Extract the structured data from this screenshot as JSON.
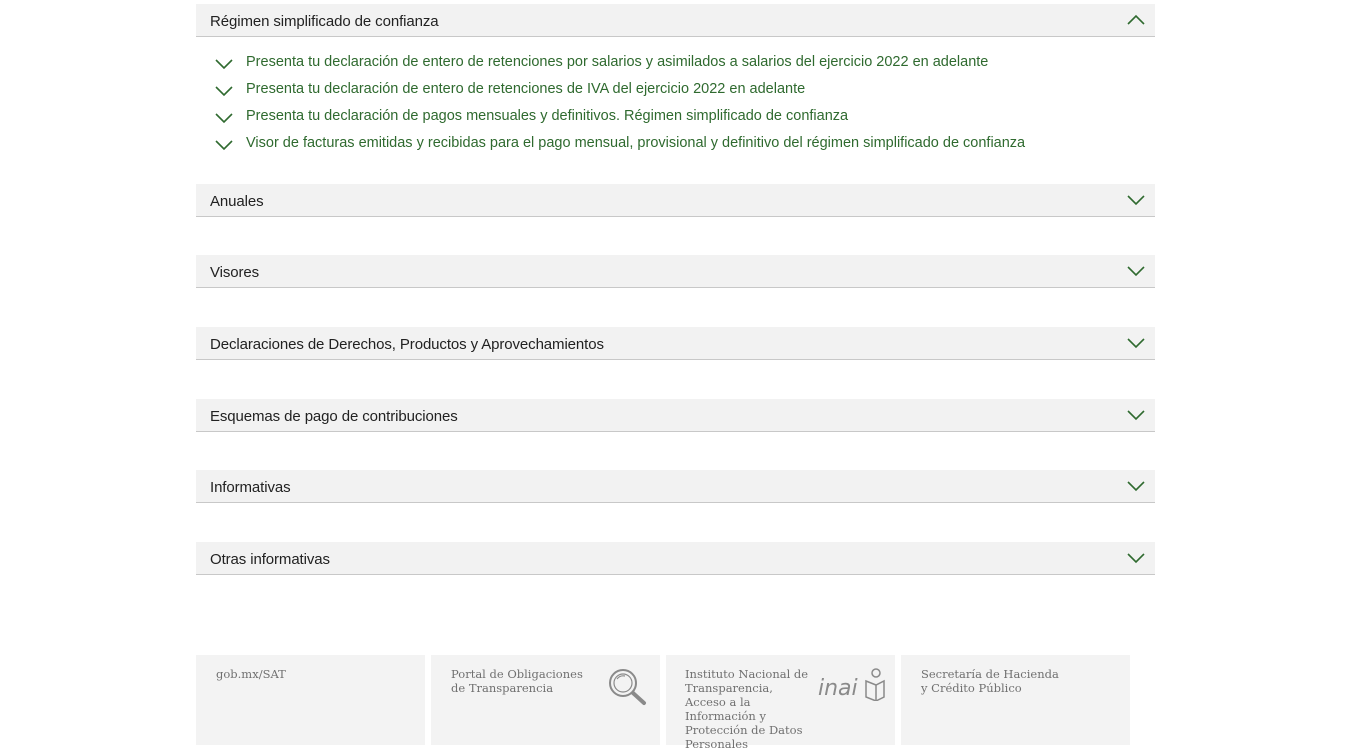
{
  "sections": {
    "regimen": {
      "title": "Régimen simplificado de confianza",
      "items": [
        "Presenta tu declaración de entero de retenciones por salarios y asimilados a salarios del ejercicio 2022 en adelante",
        "Presenta tu declaración de entero de retenciones de IVA del ejercicio 2022 en adelante",
        "Presenta tu declaración de pagos mensuales y definitivos. Régimen simplificado de confianza",
        "Visor de facturas emitidas y recibidas para el pago mensual, provisional y definitivo del régimen simplificado de confianza"
      ]
    },
    "anuales": {
      "title": "Anuales"
    },
    "visores": {
      "title": "Visores"
    },
    "derechos": {
      "title": "Declaraciones de Derechos, Productos y Aprovechamientos"
    },
    "esquemas": {
      "title": "Esquemas de pago de contribuciones"
    },
    "informativas": {
      "title": "Informativas"
    },
    "otras": {
      "title": "Otras informativas"
    }
  },
  "footer": {
    "sat": "gob.mx/SAT",
    "transparencia": "Portal de Obligaciones de Transparencia",
    "inai_text": "Instituto Nacional de Transparencia, Acceso a la Información y Protección de Datos Personales",
    "inai_logo": "inai",
    "hacienda": "Secretaría de Hacienda y Crédito Público"
  },
  "colors": {
    "accent": "#2f6a2f",
    "header_bg": "#f2f2f2"
  }
}
